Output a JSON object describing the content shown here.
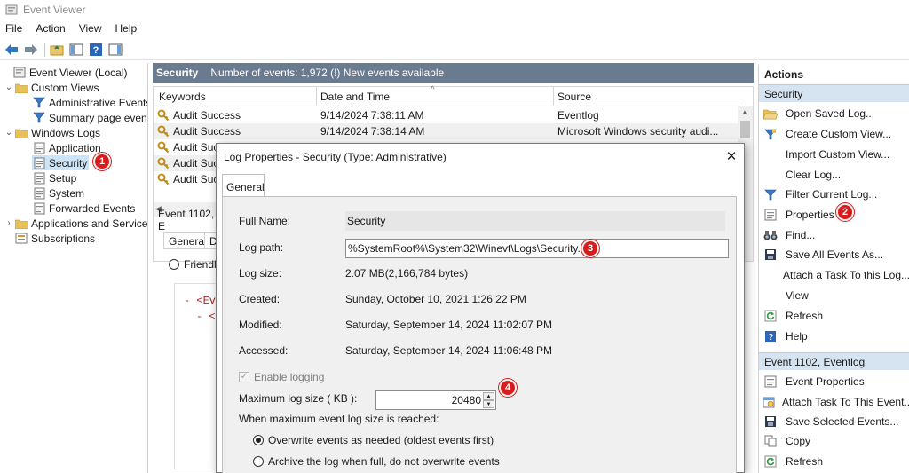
{
  "window": {
    "title": "Event Viewer"
  },
  "menu": [
    "File",
    "Action",
    "View",
    "Help"
  ],
  "tree": {
    "root": "Event Viewer (Local)",
    "custom_views": "Custom Views",
    "administrative_events": "Administrative Events",
    "summary_page_events": "Summary page events",
    "windows_logs": "Windows Logs",
    "application": "Application",
    "security": "Security",
    "setup": "Setup",
    "system": "System",
    "forwarded_events": "Forwarded Events",
    "apps_services": "Applications and Services Lo",
    "subscriptions": "Subscriptions"
  },
  "center": {
    "log_name": "Security",
    "event_count": "Number of events: 1,972 (!) New events available",
    "columns": [
      "Keywords",
      "Date and Time",
      "Source"
    ],
    "rows": [
      {
        "keywords": "Audit Success",
        "datetime": "9/14/2024 7:38:11 AM",
        "source": "Eventlog"
      },
      {
        "keywords": "Audit Success",
        "datetime": "9/14/2024 7:38:14 AM",
        "source": "Microsoft Windows security audi..."
      },
      {
        "keywords": "Audit Suc"
      },
      {
        "keywords": "Audit Suc"
      },
      {
        "keywords": "Audit Suc"
      }
    ],
    "detail_header": "Event 1102, E",
    "detail_tabs": [
      "General",
      "D"
    ],
    "friendly": "Friendly",
    "xml_lines": [
      "- <Ev",
      "- <"
    ]
  },
  "actions": {
    "title": "Actions",
    "section1": "Security",
    "items1": [
      "Open Saved Log...",
      "Create Custom View...",
      "Import Custom View...",
      "Clear Log...",
      "Filter Current Log...",
      "Properties",
      "Find...",
      "Save All Events As...",
      "Attach a Task To this Log...",
      "View",
      "Refresh",
      "Help"
    ],
    "section2": "Event 1102, Eventlog",
    "items2": [
      "Event Properties",
      "Attach Task To This Event...",
      "Save Selected Events...",
      "Copy",
      "Refresh"
    ]
  },
  "dialog": {
    "title": "Log Properties - Security (Type: Administrative)",
    "tab": "General",
    "full_name_label": "Full Name:",
    "full_name": "Security",
    "log_path_label": "Log path:",
    "log_path": "%SystemRoot%\\System32\\Winevt\\Logs\\Security.evtx",
    "log_size_label": "Log size:",
    "log_size": "2.07 MB(2,166,784 bytes)",
    "created_label": "Created:",
    "created": "Sunday, October 10, 2021 1:26:22 PM",
    "modified_label": "Modified:",
    "modified": "Saturday, September 14, 2024 11:02:07 PM",
    "accessed_label": "Accessed:",
    "accessed": "Saturday, September 14, 2024 11:06:48 PM",
    "enable_logging": "Enable logging",
    "max_size_label": "Maximum log size ( KB ):",
    "max_size": "20480",
    "when_max_label": "When maximum event log size is reached:",
    "option_overwrite": "Overwrite events as needed (oldest events first)",
    "option_archive": "Archive the log when full, do not overwrite events"
  },
  "badges": [
    "1",
    "2",
    "3",
    "4"
  ],
  "colors": {
    "section_header": "#6b7b8f",
    "selection": "#cce4f7",
    "badge": "#d81c1c",
    "actions_section": "#d6e3f1"
  }
}
